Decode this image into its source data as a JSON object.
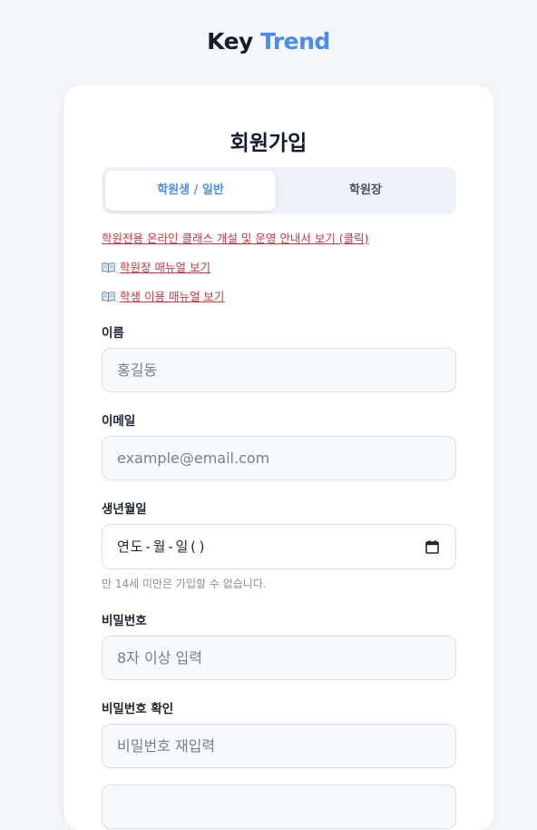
{
  "brand": {
    "key": "Key",
    "trend": "Trend",
    "key_color": "#161b2e",
    "trend_color": "#4a8cf7"
  },
  "form": {
    "title": "회원가입",
    "tabs": [
      {
        "label": "학원생 / 일반",
        "active": true
      },
      {
        "label": "학원장",
        "active": false
      }
    ],
    "links": {
      "class_guide": "학원전용 온라인 클래스 개설 및 운영 안내서 보기 (클릭)",
      "director_manual": "학원장 매뉴얼 보기",
      "student_manual": "학생 이용 매뉴얼 보기"
    },
    "fields": {
      "name": {
        "label": "이름",
        "placeholder": "홍길동",
        "value": ""
      },
      "email": {
        "label": "이메일",
        "placeholder": "example@email.com",
        "value": ""
      },
      "birthdate": {
        "label": "생년월일",
        "placeholder": "연도-월-일()",
        "hint": "만 14세 미만은 가입할 수 없습니다."
      },
      "password": {
        "label": "비밀번호",
        "placeholder": "8자 이상 입력",
        "value": ""
      },
      "password_confirm": {
        "label": "비밀번호 확인",
        "placeholder": "비밀번호 재입력",
        "value": ""
      }
    }
  },
  "colors": {
    "accent": "#4a8cf7",
    "link": "#d0353d",
    "background": "#f5f6f9"
  },
  "icons": {
    "book": "open-book-icon",
    "calendar": "calendar-icon"
  }
}
